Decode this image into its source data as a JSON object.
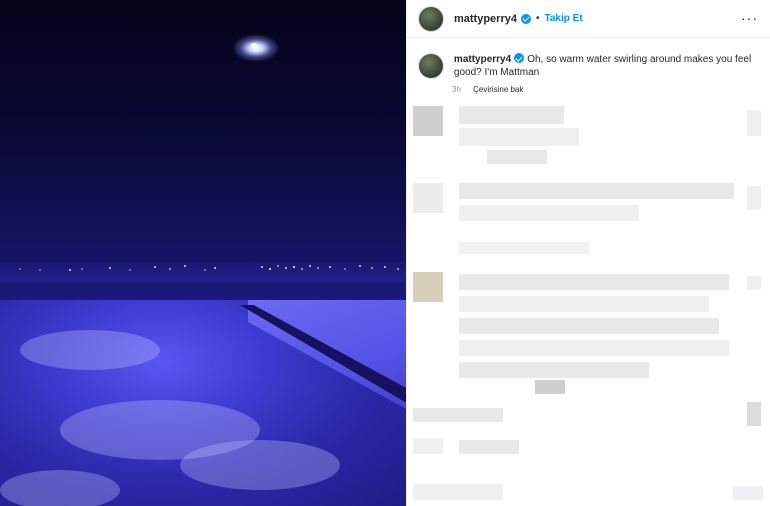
{
  "post": {
    "username": "mattyperry4",
    "separator": "•",
    "follow_label": "Takip Et",
    "more_label": "···",
    "caption": {
      "username": "mattyperry4",
      "text": "Oh, so warm water swirling around makes you feel good? I'm Mattman",
      "time": "3h",
      "translate_label": "Çevirisine bak"
    }
  },
  "colors": {
    "accent": "#0095f6",
    "media_sky": "#0b0a3a",
    "media_water": "#4c47e0"
  },
  "icons": {
    "verified": "verified-badge-icon",
    "more": "more-options-icon"
  }
}
